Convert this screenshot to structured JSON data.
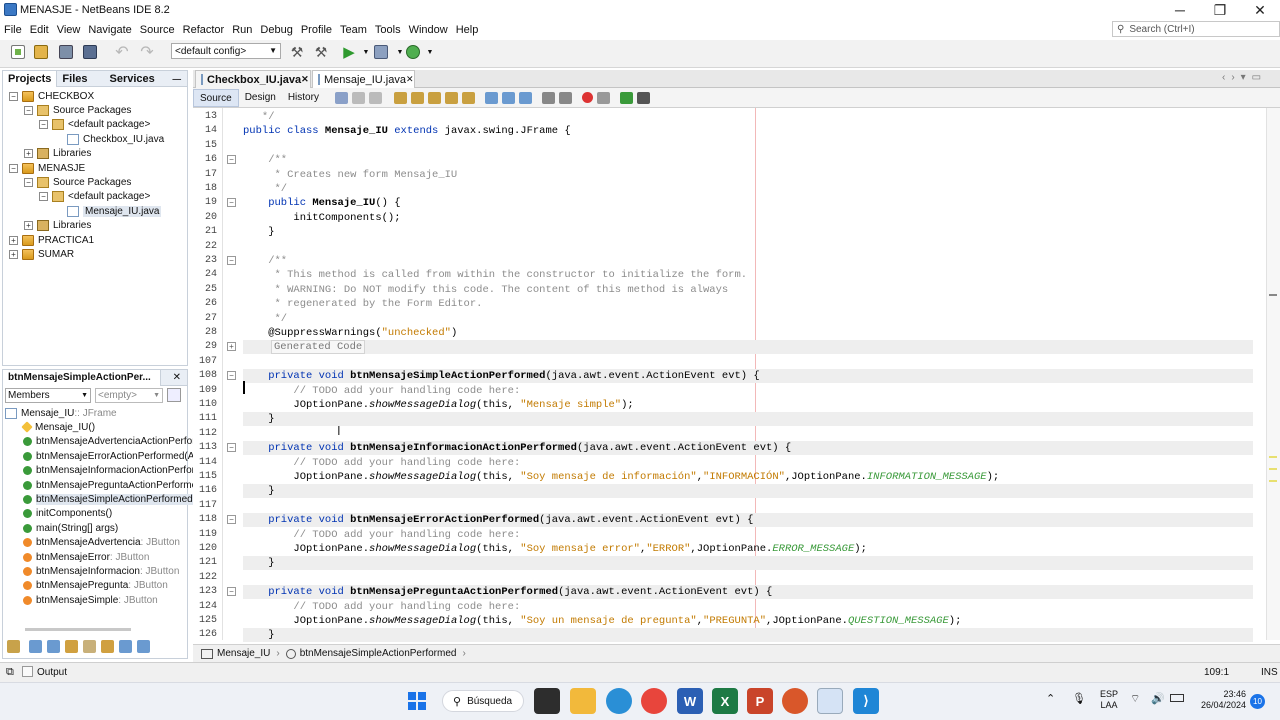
{
  "window": {
    "title": "MENASJE - NetBeans IDE 8.2",
    "minimize": "─",
    "maximize": "❐",
    "close": "✕"
  },
  "menu": [
    "File",
    "Edit",
    "View",
    "Navigate",
    "Source",
    "Refactor",
    "Run",
    "Debug",
    "Profile",
    "Team",
    "Tools",
    "Window",
    "Help"
  ],
  "search": {
    "placeholder": "Search (Ctrl+I)"
  },
  "toolbar": {
    "config": "<default config>"
  },
  "projects_panel": {
    "tabs": [
      "Projects",
      "Files",
      "Services"
    ],
    "tree": [
      {
        "label": "CHECKBOX",
        "level": 0,
        "type": "proj",
        "exp": "⊟"
      },
      {
        "label": "Source Packages",
        "level": 1,
        "type": "pkg",
        "exp": "⊟"
      },
      {
        "label": "<default package>",
        "level": 2,
        "type": "pkg",
        "exp": "⊟"
      },
      {
        "label": "Checkbox_IU.java",
        "level": 3,
        "type": "java",
        "exp": ""
      },
      {
        "label": "Libraries",
        "level": 1,
        "type": "lib",
        "exp": "⊞"
      },
      {
        "label": "MENASJE",
        "level": 0,
        "type": "proj",
        "exp": "⊟"
      },
      {
        "label": "Source Packages",
        "level": 1,
        "type": "pkg",
        "exp": "⊟"
      },
      {
        "label": "<default package>",
        "level": 2,
        "type": "pkg",
        "exp": "⊟"
      },
      {
        "label": "Mensaje_IU.java",
        "level": 3,
        "type": "java",
        "exp": "",
        "selected": true
      },
      {
        "label": "Libraries",
        "level": 1,
        "type": "lib",
        "exp": "⊞"
      },
      {
        "label": "PRACTICA1",
        "level": 0,
        "type": "proj",
        "exp": "⊞"
      },
      {
        "label": "SUMAR",
        "level": 0,
        "type": "proj",
        "exp": "⊞"
      }
    ]
  },
  "navigator": {
    "title": "btnMensajeSimpleActionPer...",
    "filter": "Members",
    "empty": "<empty>",
    "items": [
      {
        "name": "Mensaje_IU",
        "type": " :: JFrame",
        "kind": "class"
      },
      {
        "name": "Mensaje_IU()",
        "type": "",
        "kind": "ctor"
      },
      {
        "name": "btnMensajeAdvertenciaActionPerformed",
        "type": "",
        "kind": "method"
      },
      {
        "name": "btnMensajeErrorActionPerformed(Actio",
        "type": "",
        "kind": "method"
      },
      {
        "name": "btnMensajeInformacionActionPerforme",
        "type": "",
        "kind": "method"
      },
      {
        "name": "btnMensajePreguntaActionPerformed(",
        "type": "",
        "kind": "method"
      },
      {
        "name": "btnMensajeSimpleActionPerformed(Act",
        "type": "",
        "kind": "method",
        "selected": true
      },
      {
        "name": "initComponents()",
        "type": "",
        "kind": "method"
      },
      {
        "name": "main(String[] args)",
        "type": "",
        "kind": "method"
      },
      {
        "name": "btnMensajeAdvertencia",
        "type": " : JButton",
        "kind": "field"
      },
      {
        "name": "btnMensajeError",
        "type": " : JButton",
        "kind": "field"
      },
      {
        "name": "btnMensajeInformacion",
        "type": " : JButton",
        "kind": "field"
      },
      {
        "name": "btnMensajePregunta",
        "type": " : JButton",
        "kind": "field"
      },
      {
        "name": "btnMensajeSimple",
        "type": " : JButton",
        "kind": "field"
      }
    ]
  },
  "editor": {
    "tabs": [
      {
        "label": "Checkbox_IU.java",
        "active": false
      },
      {
        "label": "Mensaje_IU.java",
        "active": true
      }
    ],
    "subtabs": [
      "Source",
      "Design",
      "History"
    ],
    "lines": [
      {
        "n": "13",
        "fold": "",
        "hl": false,
        "seg": [
          [
            "cm",
            "   */"
          ]
        ]
      },
      {
        "n": "14",
        "fold": "",
        "hl": false,
        "seg": [
          [
            "kw",
            "public class "
          ],
          [
            "fn",
            "Mensaje_IU "
          ],
          [
            "kw",
            "extends "
          ],
          [
            "",
            "javax.swing.JFrame {"
          ]
        ]
      },
      {
        "n": "15",
        "fold": "",
        "hl": false,
        "seg": [
          [
            "",
            ""
          ]
        ]
      },
      {
        "n": "16",
        "fold": "−",
        "hl": false,
        "seg": [
          [
            "cm",
            "    /**"
          ]
        ]
      },
      {
        "n": "17",
        "fold": "",
        "hl": false,
        "seg": [
          [
            "cm",
            "     * Creates new form Mensaje_IU"
          ]
        ]
      },
      {
        "n": "18",
        "fold": "",
        "hl": false,
        "seg": [
          [
            "cm",
            "     */"
          ]
        ]
      },
      {
        "n": "19",
        "fold": "−",
        "hl": false,
        "seg": [
          [
            "kw",
            "    public "
          ],
          [
            "fn",
            "Mensaje_IU"
          ],
          [
            "",
            "() {"
          ]
        ]
      },
      {
        "n": "20",
        "fold": "",
        "hl": false,
        "seg": [
          [
            "",
            "        initComponents();"
          ]
        ]
      },
      {
        "n": "21",
        "fold": "",
        "hl": false,
        "seg": [
          [
            "",
            "    }"
          ]
        ]
      },
      {
        "n": "22",
        "fold": "",
        "hl": false,
        "seg": [
          [
            "",
            ""
          ]
        ]
      },
      {
        "n": "23",
        "fold": "−",
        "hl": false,
        "seg": [
          [
            "cm",
            "    /**"
          ]
        ]
      },
      {
        "n": "24",
        "fold": "",
        "hl": false,
        "seg": [
          [
            "cm",
            "     * This method is called from within the constructor to initialize the form."
          ]
        ]
      },
      {
        "n": "25",
        "fold": "",
        "hl": false,
        "seg": [
          [
            "cm",
            "     * WARNING: Do NOT modify this code. The content of this method is always"
          ]
        ]
      },
      {
        "n": "26",
        "fold": "",
        "hl": false,
        "seg": [
          [
            "cm",
            "     * regenerated by the Form Editor."
          ]
        ]
      },
      {
        "n": "27",
        "fold": "",
        "hl": false,
        "seg": [
          [
            "cm",
            "     */"
          ]
        ]
      },
      {
        "n": "28",
        "fold": "",
        "hl": false,
        "seg": [
          [
            "",
            "    @SuppressWarnings("
          ],
          [
            "st",
            "\"unchecked\""
          ],
          [
            "",
            ")"
          ]
        ]
      },
      {
        "n": "29",
        "fold": "+",
        "hl": true,
        "seg": [
          [
            "gen",
            "Generated Code"
          ]
        ]
      },
      {
        "n": "107",
        "fold": "",
        "hl": false,
        "seg": [
          [
            "",
            ""
          ]
        ]
      },
      {
        "n": "108",
        "fold": "−",
        "hl": true,
        "seg": [
          [
            "kw",
            "    private void "
          ],
          [
            "fn",
            "btnMensajeSimpleActionPerformed"
          ],
          [
            "",
            "(java.awt.event.ActionEvent evt) {"
          ]
        ]
      },
      {
        "n": "109",
        "fold": "",
        "hl": false,
        "seg": [
          [
            "cm",
            "        // TODO add your handling code here:"
          ]
        ]
      },
      {
        "n": "110",
        "fold": "",
        "hl": false,
        "seg": [
          [
            "",
            "        JOptionPane."
          ],
          [
            "it",
            "showMessageDialog"
          ],
          [
            "",
            "(this, "
          ],
          [
            "st",
            "\"Mensaje simple\""
          ],
          [
            "",
            ");"
          ]
        ]
      },
      {
        "n": "111",
        "fold": "",
        "hl": true,
        "seg": [
          [
            "",
            "    }"
          ]
        ]
      },
      {
        "n": "112",
        "fold": "",
        "hl": false,
        "seg": [
          [
            "",
            ""
          ]
        ]
      },
      {
        "n": "113",
        "fold": "−",
        "hl": true,
        "seg": [
          [
            "kw",
            "    private void "
          ],
          [
            "fn",
            "btnMensajeInformacionActionPerformed"
          ],
          [
            "",
            "(java.awt.event.ActionEvent evt) {"
          ]
        ]
      },
      {
        "n": "114",
        "fold": "",
        "hl": false,
        "seg": [
          [
            "cm",
            "        // TODO add your handling code here:"
          ]
        ]
      },
      {
        "n": "115",
        "fold": "",
        "hl": false,
        "seg": [
          [
            "",
            "        JOptionPane."
          ],
          [
            "it",
            "showMessageDialog"
          ],
          [
            "",
            "(this, "
          ],
          [
            "st",
            "\"Soy mensaje de información\""
          ],
          [
            "",
            ","
          ],
          [
            "st",
            "\"INFORMACIÓN\""
          ],
          [
            "",
            ",JOptionPane."
          ],
          [
            "cn",
            "INFORMATION_MESSAGE"
          ],
          [
            "",
            ");"
          ]
        ]
      },
      {
        "n": "116",
        "fold": "",
        "hl": true,
        "seg": [
          [
            "",
            "    }"
          ]
        ]
      },
      {
        "n": "117",
        "fold": "",
        "hl": false,
        "seg": [
          [
            "",
            ""
          ]
        ]
      },
      {
        "n": "118",
        "fold": "−",
        "hl": true,
        "seg": [
          [
            "kw",
            "    private void "
          ],
          [
            "fn",
            "btnMensajeErrorActionPerformed"
          ],
          [
            "",
            "(java.awt.event.ActionEvent evt) {"
          ]
        ]
      },
      {
        "n": "119",
        "fold": "",
        "hl": false,
        "seg": [
          [
            "cm",
            "        // TODO add your handling code here:"
          ]
        ]
      },
      {
        "n": "120",
        "fold": "",
        "hl": false,
        "seg": [
          [
            "",
            "        JOptionPane."
          ],
          [
            "it",
            "showMessageDialog"
          ],
          [
            "",
            "(this, "
          ],
          [
            "st",
            "\"Soy mensaje error\""
          ],
          [
            "",
            ","
          ],
          [
            "st",
            "\"ERROR\""
          ],
          [
            "",
            ",JOptionPane."
          ],
          [
            "cn",
            "ERROR_MESSAGE"
          ],
          [
            "",
            ");"
          ]
        ]
      },
      {
        "n": "121",
        "fold": "",
        "hl": true,
        "seg": [
          [
            "",
            "    }"
          ]
        ]
      },
      {
        "n": "122",
        "fold": "",
        "hl": false,
        "seg": [
          [
            "",
            ""
          ]
        ]
      },
      {
        "n": "123",
        "fold": "−",
        "hl": true,
        "seg": [
          [
            "kw",
            "    private void "
          ],
          [
            "fn",
            "btnMensajePreguntaActionPerformed"
          ],
          [
            "",
            "(java.awt.event.ActionEvent evt) {"
          ]
        ]
      },
      {
        "n": "124",
        "fold": "",
        "hl": false,
        "seg": [
          [
            "cm",
            "        // TODO add your handling code here:"
          ]
        ]
      },
      {
        "n": "125",
        "fold": "",
        "hl": false,
        "seg": [
          [
            "",
            "        JOptionPane."
          ],
          [
            "it",
            "showMessageDialog"
          ],
          [
            "",
            "(this, "
          ],
          [
            "st",
            "\"Soy un mensaje de pregunta\""
          ],
          [
            "",
            ","
          ],
          [
            "st",
            "\"PREGUNTA\""
          ],
          [
            "",
            ",JOptionPane."
          ],
          [
            "cn",
            "QUESTION_MESSAGE"
          ],
          [
            "",
            ");"
          ]
        ]
      },
      {
        "n": "126",
        "fold": "",
        "hl": true,
        "seg": [
          [
            "",
            "    }"
          ]
        ]
      }
    ]
  },
  "breadcrumb": [
    "Mensaje_IU",
    "btnMensajeSimpleActionPerformed"
  ],
  "status": {
    "output": "Output",
    "position": "109:1",
    "mode": "INS"
  },
  "taskbar": {
    "search": "Búsqueda",
    "lang": "ESP",
    "region": "LAA",
    "time": "23:46",
    "date": "26/04/2024",
    "badge": "10"
  }
}
